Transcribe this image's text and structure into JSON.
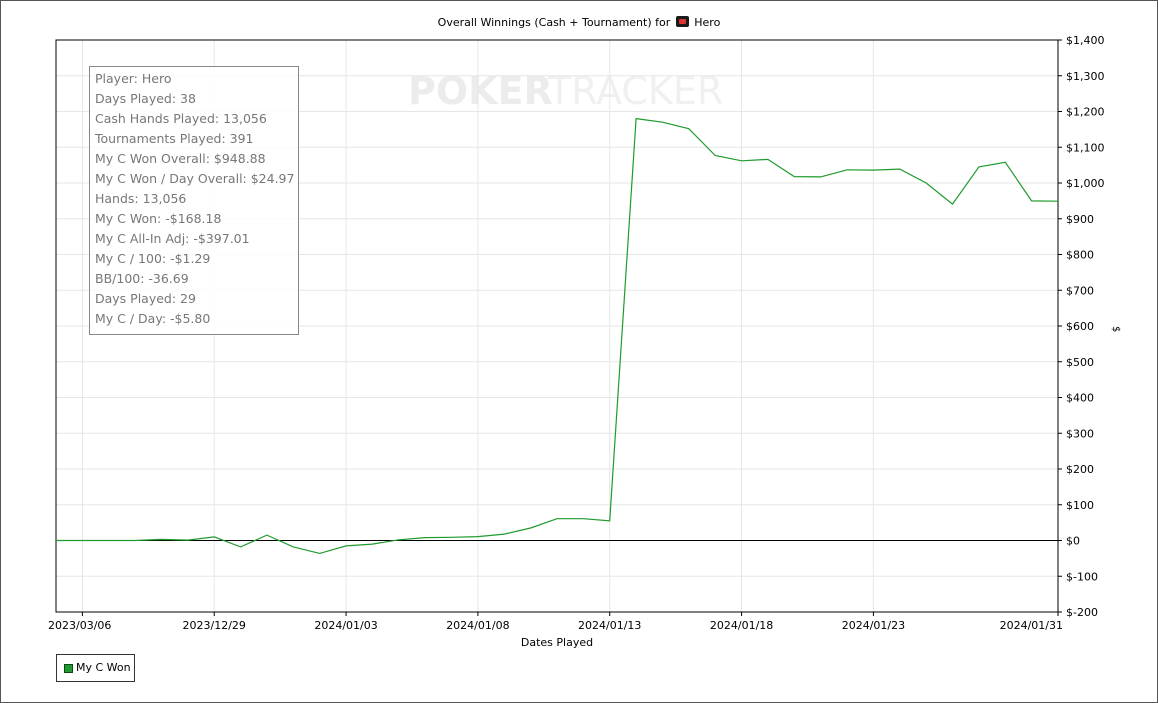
{
  "window": {
    "title_prefix": "Overall Winnings (Cash + Tournament) for",
    "site_icon": "poker-site-icon",
    "player_name": "Hero"
  },
  "watermark": {
    "text_a": "POKER",
    "text_b": "TRACKER"
  },
  "stats": [
    "Player: Hero",
    "Days Played: 38",
    "Cash Hands Played: 13,056",
    "Tournaments Played: 391",
    "My C Won Overall: $948.88",
    "My C Won / Day Overall: $24.97",
    "Hands: 13,056",
    "My C Won: -$168.18",
    "My C All-In Adj: -$397.01",
    "My C / 100: -$1.29",
    "BB/100: -36.69",
    "Days Played: 29",
    "My C / Day: -$5.80"
  ],
  "legend": {
    "label": "My C Won",
    "color": "#1f9a2e"
  },
  "chart_data": {
    "type": "line",
    "title": "Overall Winnings (Cash + Tournament) for Hero",
    "xlabel": "Dates Played",
    "ylabel": "$",
    "ylim": [
      -200,
      1400
    ],
    "yticks": [
      -200,
      -100,
      0,
      100,
      200,
      300,
      400,
      500,
      600,
      700,
      800,
      900,
      1000,
      1100,
      1200,
      1300,
      1400
    ],
    "ytick_labels": [
      "$-200",
      "$-100",
      "$0",
      "$100",
      "$200",
      "$300",
      "$400",
      "$500",
      "$600",
      "$700",
      "$800",
      "$900",
      "$1,000",
      "$1,100",
      "$1,200",
      "$1,300",
      "$1,400"
    ],
    "xtick_labels": [
      "2023/03/06",
      "2023/12/29",
      "2024/01/03",
      "2024/01/08",
      "2024/01/13",
      "2024/01/18",
      "2024/01/23",
      "2024/01/31"
    ],
    "xtick_index": [
      1,
      6,
      11,
      16,
      21,
      26,
      31,
      38
    ],
    "x_count": 38,
    "grid": true,
    "legend_position": "bottom-left",
    "series": [
      {
        "name": "My C Won",
        "color": "#1f9a2e",
        "values": [
          0,
          0,
          0,
          0,
          3,
          1,
          10,
          -18,
          15,
          -18,
          -36,
          -15,
          -10,
          2,
          8,
          9,
          11,
          18,
          35,
          61,
          61,
          55,
          1180,
          1170,
          1152,
          1077,
          1062,
          1066,
          1018,
          1017,
          1037,
          1036,
          1039,
          1000,
          941,
          1045,
          1058,
          950,
          949
        ]
      }
    ]
  }
}
